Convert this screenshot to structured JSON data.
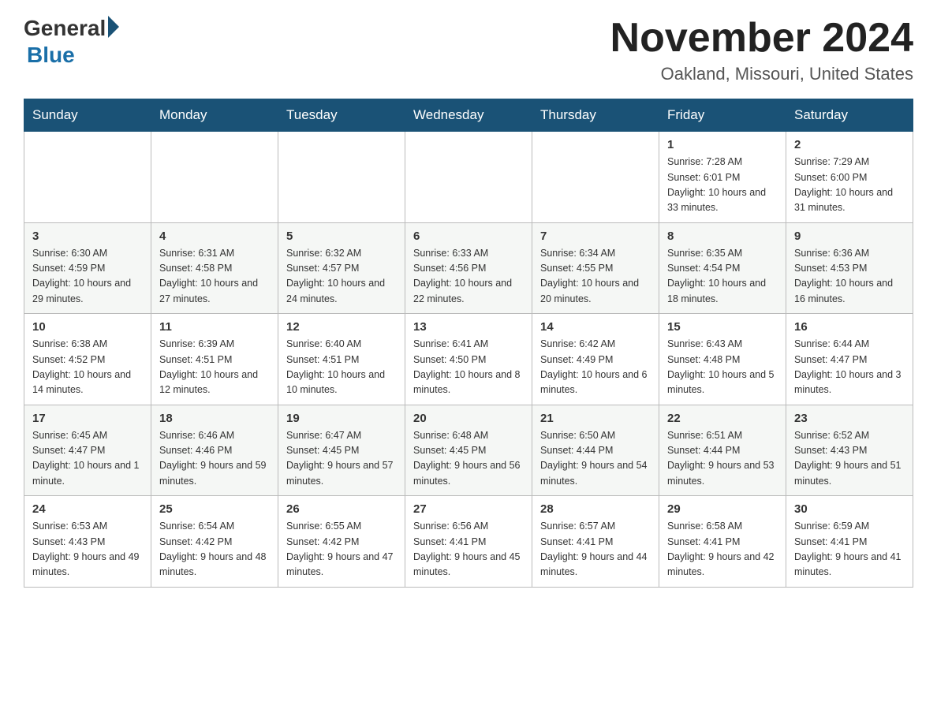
{
  "header": {
    "logo_general": "General",
    "logo_blue": "Blue",
    "title": "November 2024",
    "location": "Oakland, Missouri, United States"
  },
  "weekdays": [
    "Sunday",
    "Monday",
    "Tuesday",
    "Wednesday",
    "Thursday",
    "Friday",
    "Saturday"
  ],
  "weeks": [
    [
      {
        "day": "",
        "info": ""
      },
      {
        "day": "",
        "info": ""
      },
      {
        "day": "",
        "info": ""
      },
      {
        "day": "",
        "info": ""
      },
      {
        "day": "",
        "info": ""
      },
      {
        "day": "1",
        "info": "Sunrise: 7:28 AM\nSunset: 6:01 PM\nDaylight: 10 hours and 33 minutes."
      },
      {
        "day": "2",
        "info": "Sunrise: 7:29 AM\nSunset: 6:00 PM\nDaylight: 10 hours and 31 minutes."
      }
    ],
    [
      {
        "day": "3",
        "info": "Sunrise: 6:30 AM\nSunset: 4:59 PM\nDaylight: 10 hours and 29 minutes."
      },
      {
        "day": "4",
        "info": "Sunrise: 6:31 AM\nSunset: 4:58 PM\nDaylight: 10 hours and 27 minutes."
      },
      {
        "day": "5",
        "info": "Sunrise: 6:32 AM\nSunset: 4:57 PM\nDaylight: 10 hours and 24 minutes."
      },
      {
        "day": "6",
        "info": "Sunrise: 6:33 AM\nSunset: 4:56 PM\nDaylight: 10 hours and 22 minutes."
      },
      {
        "day": "7",
        "info": "Sunrise: 6:34 AM\nSunset: 4:55 PM\nDaylight: 10 hours and 20 minutes."
      },
      {
        "day": "8",
        "info": "Sunrise: 6:35 AM\nSunset: 4:54 PM\nDaylight: 10 hours and 18 minutes."
      },
      {
        "day": "9",
        "info": "Sunrise: 6:36 AM\nSunset: 4:53 PM\nDaylight: 10 hours and 16 minutes."
      }
    ],
    [
      {
        "day": "10",
        "info": "Sunrise: 6:38 AM\nSunset: 4:52 PM\nDaylight: 10 hours and 14 minutes."
      },
      {
        "day": "11",
        "info": "Sunrise: 6:39 AM\nSunset: 4:51 PM\nDaylight: 10 hours and 12 minutes."
      },
      {
        "day": "12",
        "info": "Sunrise: 6:40 AM\nSunset: 4:51 PM\nDaylight: 10 hours and 10 minutes."
      },
      {
        "day": "13",
        "info": "Sunrise: 6:41 AM\nSunset: 4:50 PM\nDaylight: 10 hours and 8 minutes."
      },
      {
        "day": "14",
        "info": "Sunrise: 6:42 AM\nSunset: 4:49 PM\nDaylight: 10 hours and 6 minutes."
      },
      {
        "day": "15",
        "info": "Sunrise: 6:43 AM\nSunset: 4:48 PM\nDaylight: 10 hours and 5 minutes."
      },
      {
        "day": "16",
        "info": "Sunrise: 6:44 AM\nSunset: 4:47 PM\nDaylight: 10 hours and 3 minutes."
      }
    ],
    [
      {
        "day": "17",
        "info": "Sunrise: 6:45 AM\nSunset: 4:47 PM\nDaylight: 10 hours and 1 minute."
      },
      {
        "day": "18",
        "info": "Sunrise: 6:46 AM\nSunset: 4:46 PM\nDaylight: 9 hours and 59 minutes."
      },
      {
        "day": "19",
        "info": "Sunrise: 6:47 AM\nSunset: 4:45 PM\nDaylight: 9 hours and 57 minutes."
      },
      {
        "day": "20",
        "info": "Sunrise: 6:48 AM\nSunset: 4:45 PM\nDaylight: 9 hours and 56 minutes."
      },
      {
        "day": "21",
        "info": "Sunrise: 6:50 AM\nSunset: 4:44 PM\nDaylight: 9 hours and 54 minutes."
      },
      {
        "day": "22",
        "info": "Sunrise: 6:51 AM\nSunset: 4:44 PM\nDaylight: 9 hours and 53 minutes."
      },
      {
        "day": "23",
        "info": "Sunrise: 6:52 AM\nSunset: 4:43 PM\nDaylight: 9 hours and 51 minutes."
      }
    ],
    [
      {
        "day": "24",
        "info": "Sunrise: 6:53 AM\nSunset: 4:43 PM\nDaylight: 9 hours and 49 minutes."
      },
      {
        "day": "25",
        "info": "Sunrise: 6:54 AM\nSunset: 4:42 PM\nDaylight: 9 hours and 48 minutes."
      },
      {
        "day": "26",
        "info": "Sunrise: 6:55 AM\nSunset: 4:42 PM\nDaylight: 9 hours and 47 minutes."
      },
      {
        "day": "27",
        "info": "Sunrise: 6:56 AM\nSunset: 4:41 PM\nDaylight: 9 hours and 45 minutes."
      },
      {
        "day": "28",
        "info": "Sunrise: 6:57 AM\nSunset: 4:41 PM\nDaylight: 9 hours and 44 minutes."
      },
      {
        "day": "29",
        "info": "Sunrise: 6:58 AM\nSunset: 4:41 PM\nDaylight: 9 hours and 42 minutes."
      },
      {
        "day": "30",
        "info": "Sunrise: 6:59 AM\nSunset: 4:41 PM\nDaylight: 9 hours and 41 minutes."
      }
    ]
  ]
}
